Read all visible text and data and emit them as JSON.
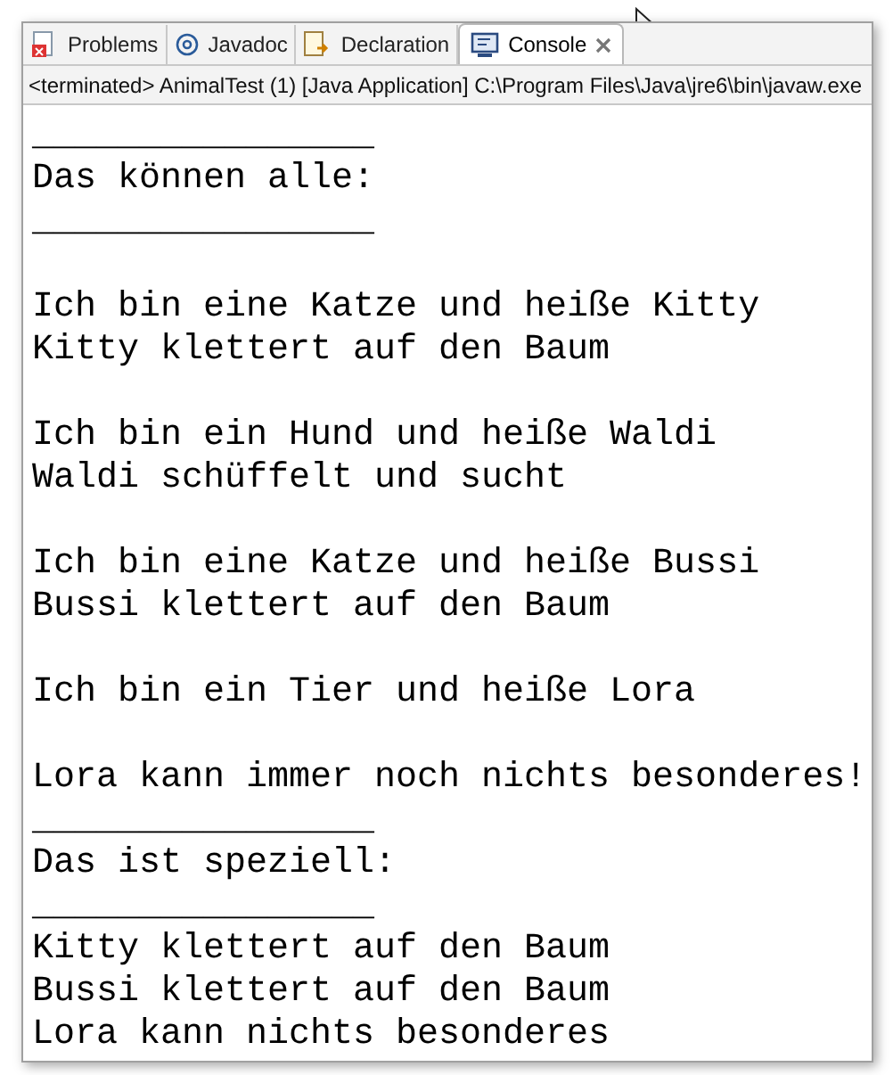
{
  "tabs": [
    {
      "label": "Problems",
      "kind": "problems",
      "selected": false,
      "closable": false
    },
    {
      "label": "Javadoc",
      "kind": "javadoc",
      "selected": false,
      "closable": false
    },
    {
      "label": "Declaration",
      "kind": "declaration",
      "selected": false,
      "closable": false
    },
    {
      "label": "Console",
      "kind": "console",
      "selected": true,
      "closable": true
    }
  ],
  "status": "<terminated> AnimalTest (1) [Java Application] C:\\Program Files\\Java\\jre6\\bin\\javaw.exe",
  "console_blocks": [
    [
      "________________",
      "Das können alle:",
      "________________"
    ],
    [
      "Ich bin eine Katze und heiße Kitty",
      "Kitty klettert auf den Baum"
    ],
    [
      "Ich bin ein Hund und heiße Waldi",
      "Waldi schüffelt und sucht"
    ],
    [
      "Ich bin eine Katze und heiße Bussi",
      "Bussi klettert auf den Baum"
    ],
    [
      "Ich bin ein Tier und heiße Lora"
    ],
    [
      "Lora kann immer noch nichts besonderes!",
      "________________",
      "Das ist speziell:",
      "________________",
      "Kitty klettert auf den Baum",
      "Bussi klettert auf den Baum",
      "Lora kann nichts besonderes"
    ]
  ]
}
